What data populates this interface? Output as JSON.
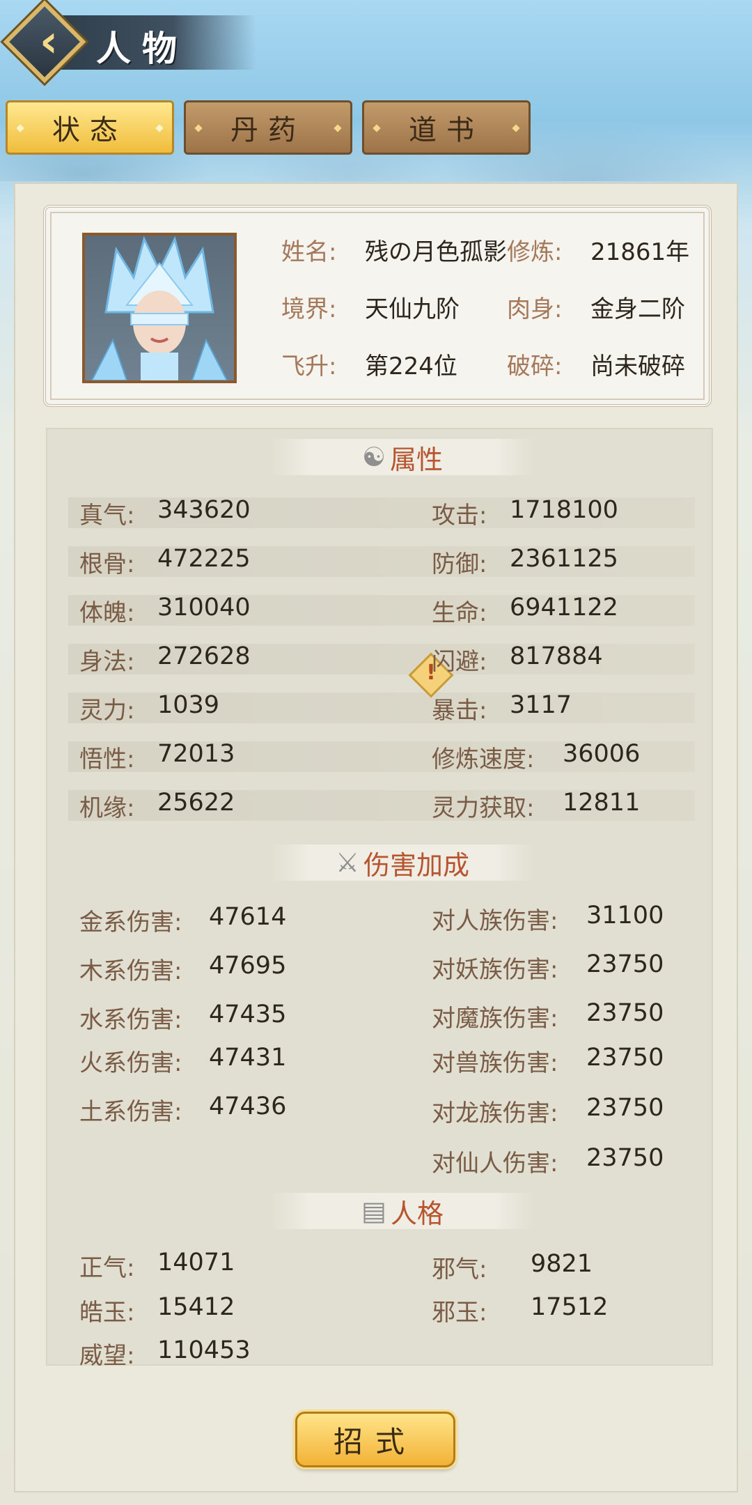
{
  "header": {
    "title": "人物",
    "back_icon": "back-arrow-icon"
  },
  "tabs": [
    {
      "label": "状态",
      "active": true
    },
    {
      "label": "丹药",
      "active": false
    },
    {
      "label": "道书",
      "active": false
    }
  ],
  "profile": {
    "name_label": "姓名",
    "name_value": "残の月色孤影",
    "cultivation_label": "修炼",
    "cultivation_value": "21861年",
    "realm_label": "境界",
    "realm_value": "天仙九阶",
    "body_label": "肉身",
    "body_value": "金身二阶",
    "ascend_label": "飞升",
    "ascend_value": "第224位",
    "shatter_label": "破碎",
    "shatter_value": "尚未破碎"
  },
  "sections": {
    "attributes": "属性",
    "damage_bonus": "伤害加成",
    "personality": "人格"
  },
  "attributes_left": [
    {
      "label": "真气",
      "value": "343620"
    },
    {
      "label": "根骨",
      "value": "472225"
    },
    {
      "label": "体魄",
      "value": "310040"
    },
    {
      "label": "身法",
      "value": "272628"
    },
    {
      "label": "灵力",
      "value": "1039"
    },
    {
      "label": "悟性",
      "value": "72013"
    },
    {
      "label": "机缘",
      "value": "25622"
    }
  ],
  "attributes_right": [
    {
      "label": "攻击",
      "value": "1718100"
    },
    {
      "label": "防御",
      "value": "2361125"
    },
    {
      "label": "生命",
      "value": "6941122"
    },
    {
      "label": "闪避",
      "value": "817884"
    },
    {
      "label": "暴击",
      "value": "3117"
    },
    {
      "label": "修炼速度",
      "value": "36006"
    },
    {
      "label": "灵力获取",
      "value": "12811"
    }
  ],
  "damage_left": [
    {
      "label": "金系伤害",
      "value": "47614"
    },
    {
      "label": "木系伤害",
      "value": "47695"
    },
    {
      "label": "水系伤害",
      "value": "47435"
    },
    {
      "label": "火系伤害",
      "value": "47431"
    },
    {
      "label": "土系伤害",
      "value": "47436"
    }
  ],
  "damage_right": [
    {
      "label": "对人族伤害",
      "value": "31100"
    },
    {
      "label": "对妖族伤害",
      "value": "23750"
    },
    {
      "label": "对魔族伤害",
      "value": "23750"
    },
    {
      "label": "对兽族伤害",
      "value": "23750"
    },
    {
      "label": "对龙族伤害",
      "value": "23750"
    },
    {
      "label": "对仙人伤害",
      "value": "23750"
    }
  ],
  "personality_left": [
    {
      "label": "正气",
      "value": "14071"
    },
    {
      "label": "皓玉",
      "value": "15412"
    },
    {
      "label": "威望",
      "value": "110453"
    }
  ],
  "personality_right": [
    {
      "label": "邪气",
      "value": "9821"
    },
    {
      "label": "邪玉",
      "value": "17512"
    }
  ],
  "bottom_button": "招式",
  "colors": {
    "accent_gold": "#f2b236",
    "section_title": "#b6552f",
    "label": "#7a5b45"
  }
}
